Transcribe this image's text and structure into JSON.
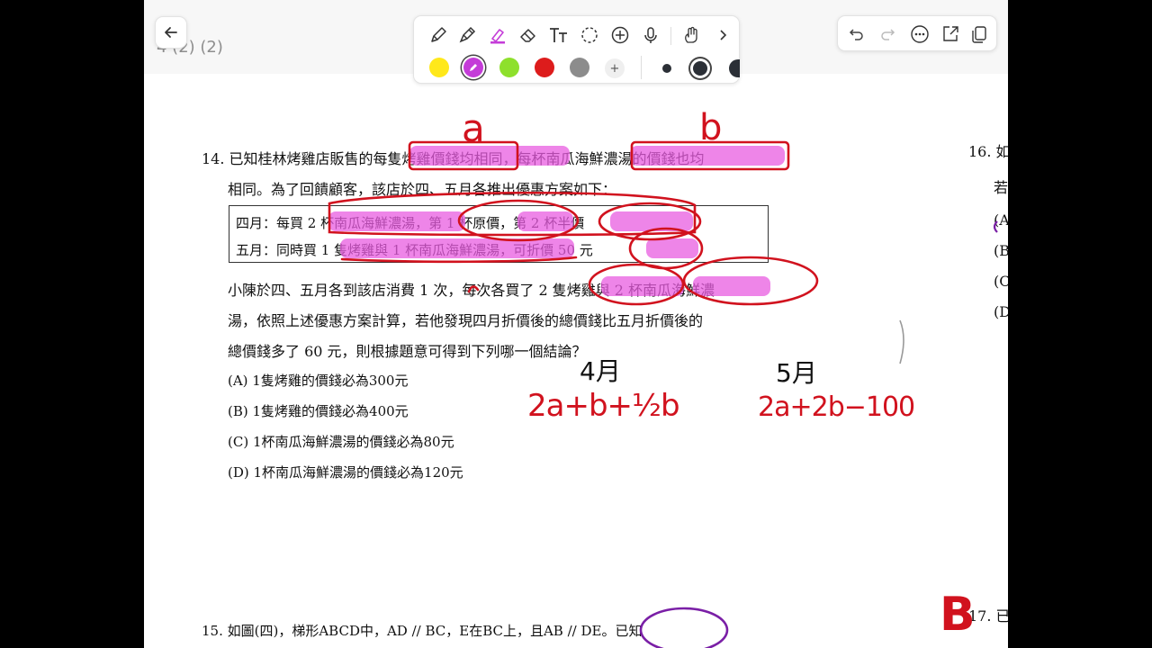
{
  "document": {
    "title": "4 (2) (2)"
  },
  "toolbar": {
    "tools": [
      "pen-icon",
      "fountain-pen-icon",
      "highlighter-icon",
      "eraser-icon",
      "text-icon",
      "lasso-icon",
      "add-icon",
      "microphone-icon",
      "hand-draw-icon",
      "chevron-right-icon"
    ],
    "colors": [
      "#ffe81a",
      "#c43cd8",
      "#8ee02c",
      "#dd1c1c",
      "#8c8c8c"
    ],
    "add_color_label": "+",
    "stroke_widths": [
      "thin",
      "medium",
      "thick"
    ],
    "right_actions": [
      "undo-icon",
      "redo-icon",
      "more-icon",
      "export-icon",
      "copy-icon"
    ]
  },
  "question14": {
    "number": "14.",
    "line1": "已知桂林烤雞店販售的每隻烤雞價錢均相同，每杯南瓜海鮮濃湯的價錢也均",
    "line2": "相同。為了回饋顧客，該店於四、五月各推出優惠方案如下：",
    "offers": [
      "四月：每買 2 杯南瓜海鮮濃湯，第 1 杯原價，第 2 杯半價",
      "五月：同時買 1 隻烤雞與 1 杯南瓜海鮮濃湯，可折價 50 元"
    ],
    "line3": "小陳於四、五月各到該店消費 1 次，每次各買了 2 隻烤雞與 2 杯南瓜海鮮濃",
    "line4": "湯，依照上述優惠方案計算，若他發現四月折價後的總價錢比五月折價後的",
    "line5": "總價錢多了 60 元，則根據題意可得到下列哪一個結論？",
    "options": [
      "(A) 1隻烤雞的價錢必為300元",
      "(B) 1隻烤雞的價錢必為400元",
      "(C) 1杯南瓜海鮮濃湯的價錢必為80元",
      "(D) 1杯南瓜海鮮濃湯的價錢必為120元"
    ]
  },
  "question15": {
    "text": "15. 如圖(四)，梯形ABCD中，AD // BC，E在BC上，且AB // DE。已知"
  },
  "side_column": {
    "q16_number": "16. 如",
    "q16_line2": "若",
    "options": [
      "(A",
      "(B",
      "(C",
      "(D"
    ],
    "q17_number": "17. 已"
  },
  "handwriting": {
    "label_a": "a",
    "label_b": "b",
    "april_label": "4月",
    "may_label": "5月",
    "april_expr": "2a+b+½b",
    "may_expr": "2a+2b−100",
    "answer": "B"
  }
}
